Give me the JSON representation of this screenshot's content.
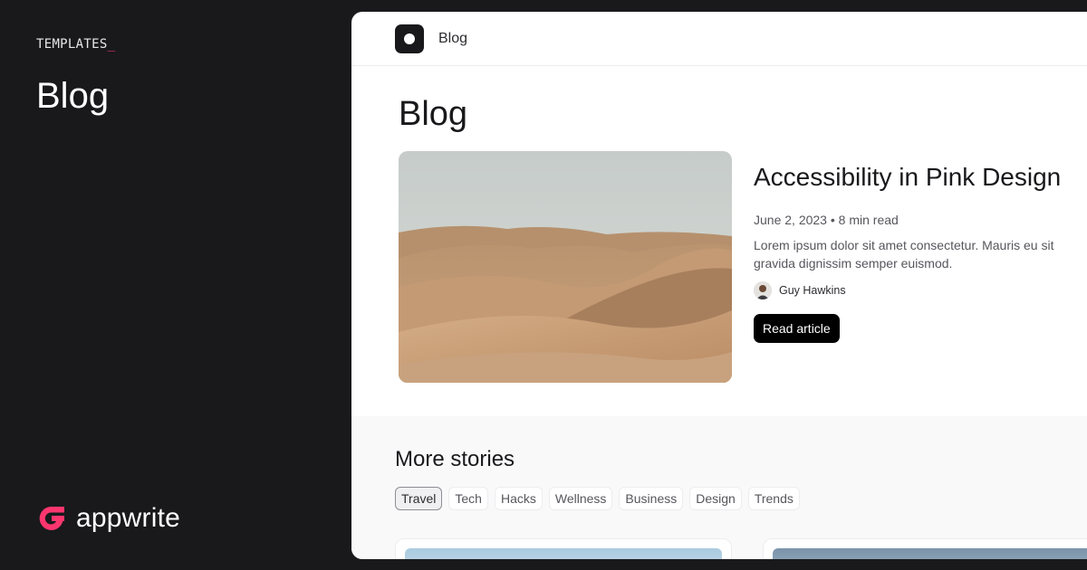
{
  "left_panel": {
    "kicker": "TEMPLATES",
    "kicker_cursor": "_",
    "title": "Blog",
    "brand_name": "appwrite",
    "brand_color": "#fd366e"
  },
  "window": {
    "topbar": {
      "title": "Blog",
      "logo_icon": "circle-logo-icon"
    },
    "page_title": "Blog",
    "featured": {
      "title": "Accessibility in Pink Design",
      "date": "June 2, 2023",
      "read_time": "8 min read",
      "excerpt": "Lorem ipsum dolor sit amet consectetur. Mauris eu sit gravida dignissim semper euismod.",
      "author": "Guy Hawkins",
      "button": "Read article",
      "image": "desert-dunes"
    },
    "stories": {
      "title": "More stories",
      "tags": [
        "Travel",
        "Tech",
        "Hacks",
        "Wellness",
        "Business",
        "Design",
        "Trends"
      ],
      "active_tag": "Travel"
    }
  }
}
